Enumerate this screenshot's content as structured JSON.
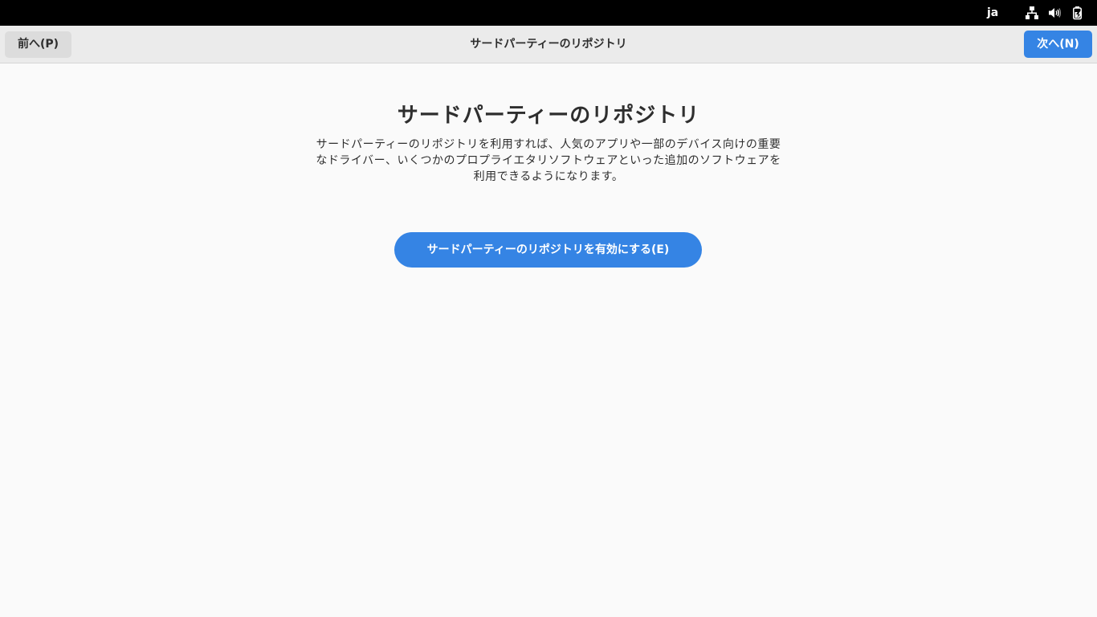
{
  "topbar": {
    "language": "ja",
    "icons": [
      "network-wired-icon",
      "volume-icon",
      "battery-charging-icon"
    ]
  },
  "header": {
    "prev_label": "前へ(P)",
    "title": "サードパーティーのリポジトリ",
    "next_label": "次へ(N)"
  },
  "main": {
    "title": "サードパーティーのリポジトリ",
    "description": "サードパーティーのリポジトリを利用すれば、人気のアプリや一部のデバイス向けの重要なドライバー、いくつかのプロプライエタリソフトウェアといった追加のソフトウェアを利用できるようになります。",
    "enable_button_label": "サードパーティーのリポジトリを有効にする(E)"
  },
  "colors": {
    "accent": "#3584e4",
    "topbar_bg": "#000000",
    "header_bg": "#ebebeb",
    "content_bg": "#fafafa",
    "text": "#2e2e2e"
  }
}
